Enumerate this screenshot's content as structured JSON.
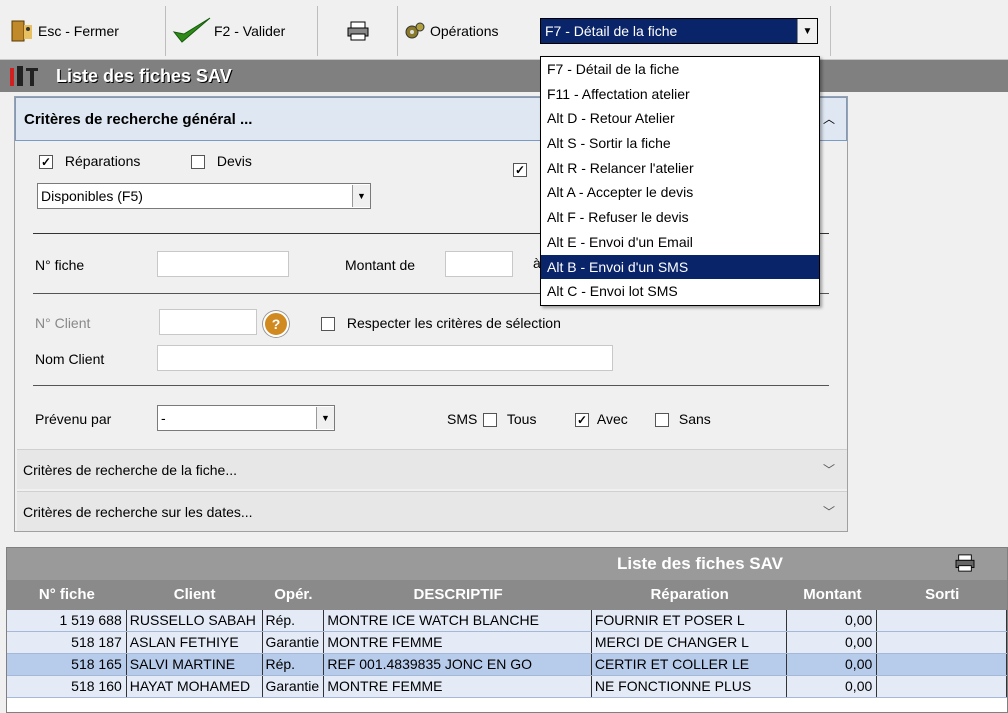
{
  "toolbar": {
    "close_label": "Esc - Fermer",
    "validate_label": "F2 - Valider",
    "operations_label": "Opérations",
    "operations_selected": "F7 - Détail de la fiche"
  },
  "window_title": "Liste des fiches SAV",
  "criteria": {
    "general_title": "Critères de recherche général ...",
    "reparations_label": "Réparations",
    "devis_label": "Devis",
    "status_select": "Disponibles (F5)",
    "fiche_label": "N° fiche",
    "montant_label": "Montant de",
    "montant_to": "à",
    "client_num_label": "N° Client",
    "respect_label": "Respecter les critères de sélection",
    "nom_client_label": "Nom Client",
    "prevenu_label": "Prévenu par",
    "prevenu_value": "-",
    "sms_label": "SMS",
    "tous_label": "Tous",
    "avec_label": "Avec",
    "sans_label": "Sans",
    "fiche_section": "Critères de recherche de la fiche...",
    "dates_section": "Critères de recherche sur les dates..."
  },
  "operations_menu": [
    "F7 - Détail de la fiche",
    "F11 - Affectation atelier",
    "Alt D - Retour Atelier",
    "Alt S - Sortir la fiche",
    "Alt R - Relancer l'atelier",
    "Alt A - Accepter le devis",
    "Alt F - Refuser le devis",
    "Alt E - Envoi d'un Email",
    "Alt B - Envoi d'un SMS",
    "Alt C - Envoi lot SMS"
  ],
  "grid": {
    "title": "Liste des fiches SAV",
    "columns": [
      "N° fiche",
      "Client",
      "Opér.",
      "DESCRIPTIF",
      "Réparation",
      "Montant",
      "Sorti"
    ],
    "rows": [
      {
        "fiche": "1 519 688",
        "client": "RUSSELLO SABAH",
        "oper": "Rép.",
        "desc": "MONTRE ICE WATCH BLANCHE",
        "rep": "FOURNIR  ET POSER L",
        "montant": "0,00",
        "sorti": ""
      },
      {
        "fiche": "518 187",
        "client": "ASLAN FETHIYE",
        "oper": "Garantie",
        "desc": "MONTRE FEMME",
        "rep": "MERCI DE CHANGER L",
        "montant": "0,00",
        "sorti": ""
      },
      {
        "fiche": "518 165",
        "client": "SALVI MARTINE",
        "oper": "Rép.",
        "desc": "REF 001.4839835  JONC EN GO",
        "rep": "CERTIR ET COLLER LE",
        "montant": "0,00",
        "sorti": ""
      },
      {
        "fiche": "518 160",
        "client": "HAYAT MOHAMED",
        "oper": "Garantie",
        "desc": "MONTRE FEMME",
        "rep": "NE FONCTIONNE PLUS",
        "montant": "0,00",
        "sorti": ""
      }
    ]
  }
}
